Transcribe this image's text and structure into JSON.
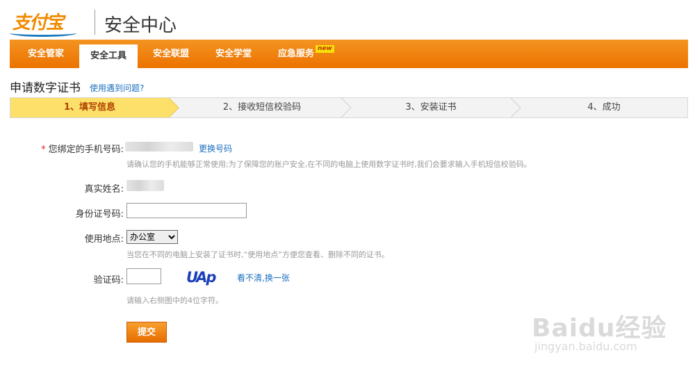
{
  "header": {
    "logo_text": "支付宝",
    "title": "安全中心"
  },
  "nav": {
    "items": [
      {
        "label": "安全管家",
        "active": false
      },
      {
        "label": "安全工具",
        "active": true
      },
      {
        "label": "安全联盟",
        "active": false
      },
      {
        "label": "安全学堂",
        "active": false
      },
      {
        "label": "应急服务",
        "active": false
      }
    ],
    "new_badge": "new"
  },
  "page": {
    "title": "申请数字证书",
    "help_link": "使用遇到问题?"
  },
  "steps": [
    {
      "label": "1、填写信息",
      "active": true
    },
    {
      "label": "2、接收短信校验码",
      "active": false
    },
    {
      "label": "3、安装证书",
      "active": false
    },
    {
      "label": "4、成功",
      "active": false
    }
  ],
  "form": {
    "phone": {
      "required_mark": "*",
      "label": "您绑定的手机号码:",
      "change_link": "更换号码",
      "hint": "请确认您的手机能够正常使用;为了保障您的账户安全,在不同的电脑上使用数字证书时,我们会要求输入手机短信校验码。"
    },
    "name": {
      "label": "真实姓名:"
    },
    "id_number": {
      "label": "身份证号码:",
      "value": ""
    },
    "location": {
      "label": "使用地点:",
      "selected": "办公室",
      "hint": "当您在不同的电脑上安装了证书时,“使用地点”方便您查看、删除不同的证书。"
    },
    "captcha": {
      "label": "验证码:",
      "value": "",
      "image_text": "UAp",
      "refresh_link": "看不清,换一张",
      "hint": "请输入右侧图中的4位字符。"
    },
    "submit_label": "提交"
  },
  "watermark": {
    "main": "Baidu经验",
    "sub": "jingyan.baidu.com"
  },
  "colors": {
    "nav_orange": "#ef7d0a",
    "link_blue": "#1a6fc0",
    "step_active": "#fde06a",
    "required_red": "#e02020"
  }
}
